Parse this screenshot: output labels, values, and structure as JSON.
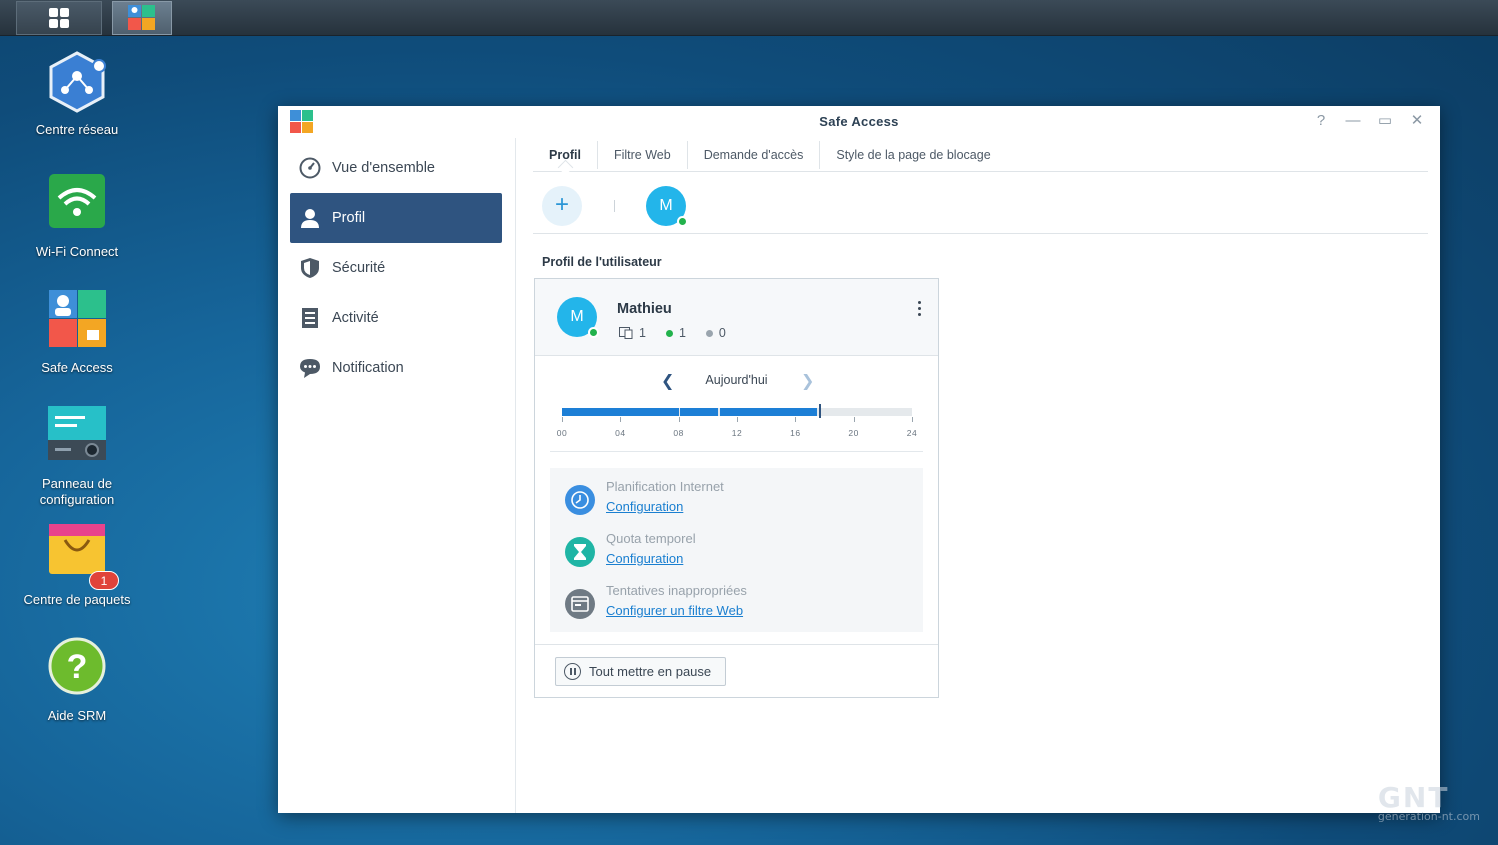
{
  "taskbar": {
    "main_menu": "main-menu",
    "active_app": "safe-access"
  },
  "desktop": {
    "icons": [
      {
        "label": "Centre réseau"
      },
      {
        "label": "Wi-Fi Connect"
      },
      {
        "label": "Safe Access"
      },
      {
        "label": "Panneau de configuration"
      },
      {
        "label": "Centre de paquets",
        "badge": "1"
      },
      {
        "label": "Aide SRM"
      }
    ]
  },
  "window": {
    "title": "Safe Access",
    "controls": [
      "help",
      "minimize",
      "maximize",
      "close"
    ]
  },
  "sidebar": {
    "items": [
      {
        "label": "Vue d'ensemble",
        "icon": "gauge-icon"
      },
      {
        "label": "Profil",
        "icon": "user-icon",
        "active": true
      },
      {
        "label": "Sécurité",
        "icon": "shield-icon"
      },
      {
        "label": "Activité",
        "icon": "list-icon"
      },
      {
        "label": "Notification",
        "icon": "chat-icon"
      }
    ]
  },
  "tabs": [
    {
      "label": "Profil",
      "active": true
    },
    {
      "label": "Filtre Web"
    },
    {
      "label": "Demande d'accès"
    },
    {
      "label": "Style de la page de blocage"
    }
  ],
  "profile_bar": {
    "add_label": "+",
    "avatar_letter": "M"
  },
  "section_title": "Profil de l'utilisateur",
  "card": {
    "avatar_letter": "M",
    "name": "Mathieu",
    "stats": {
      "devices": "1",
      "online": "1",
      "offline": "0"
    },
    "day_label": "Aujourd'hui",
    "timeline": {
      "ticks": [
        "00",
        "04",
        "08",
        "12",
        "16",
        "20",
        "24"
      ],
      "segments_hours": [
        [
          0,
          8
        ],
        [
          8.1,
          10.7
        ],
        [
          10.8,
          17.5
        ]
      ],
      "current_hour": 17.6
    },
    "features": [
      {
        "title": "Planification Internet",
        "link": "Configuration",
        "icon": "clock-icon",
        "color": "#3a8ee0"
      },
      {
        "title": "Quota temporel",
        "link": "Configuration",
        "icon": "hourglass-icon",
        "color": "#1fb5a5"
      },
      {
        "title": "Tentatives inappropriées",
        "link": "Configurer un filtre Web",
        "icon": "browser-icon",
        "color": "#6f7a84"
      }
    ],
    "pause_label": "Tout mettre en pause"
  },
  "watermark": {
    "text": "GNT",
    "sub": "generation-nt.com"
  },
  "colors": {
    "accent": "#2f5480",
    "link": "#1a7fd0",
    "avatar": "#23b5ea",
    "online": "#22b24c"
  }
}
